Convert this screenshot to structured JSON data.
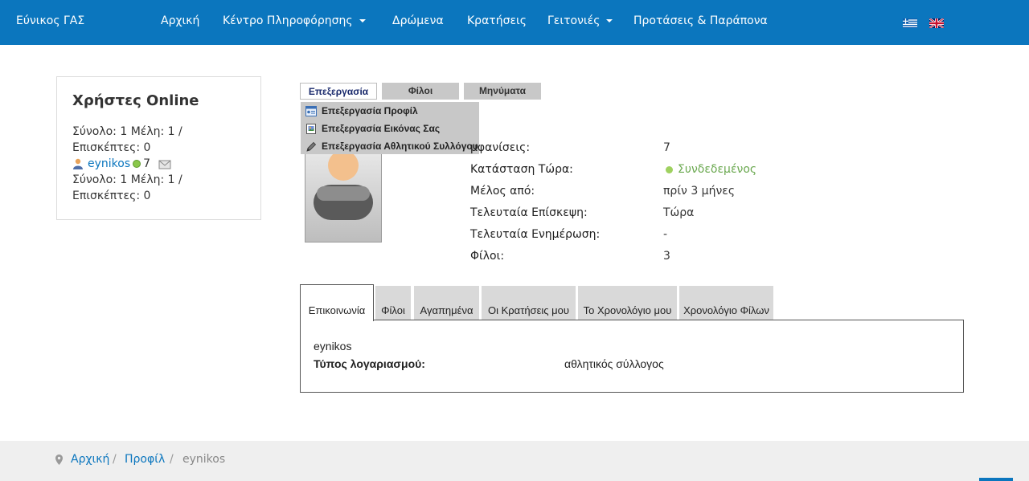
{
  "navbar": {
    "brand": "Εύνικος ΓΑΣ",
    "items": [
      {
        "label": "Αρχική"
      },
      {
        "label": "Κέντρο Πληροφόρησης"
      },
      {
        "label": "Δρώμενα"
      },
      {
        "label": "Κρατήσεις"
      },
      {
        "label": "Γειτονιές"
      },
      {
        "label": "Προτάσεις & Παράπονα"
      }
    ]
  },
  "sidebar": {
    "title": "Χρήστες Online",
    "line1": "Σύνολο: 1 Μέλη: 1 /",
    "line2": "Επισκέπτες: 0",
    "user": "eynikos",
    "user_count": "7",
    "line3": "Σύνολο: 1 Μέλη: 1 /",
    "line4": "Επισκέπτες: 0"
  },
  "profile_tabs": {
    "edit": "Επεξεργασία",
    "friends": "Φίλοι",
    "messages": "Μηνύματα"
  },
  "edit_menu": {
    "items": [
      {
        "label": "Επεξεργασία Προφίλ",
        "icon": "profile-card-icon"
      },
      {
        "label": "Επεξεργασία Εικόνας Σας",
        "icon": "image-icon"
      },
      {
        "label": "Επεξεργασία Αθλητικού Συλλόγου",
        "icon": "pencil-icon"
      }
    ]
  },
  "info": {
    "views_label": "μφανίσεις:",
    "views_value": "7",
    "status_label": "Κατάσταση Τώρα:",
    "status_value": "Συνδεδεμένος",
    "member_since_label": "Μέλος από:",
    "member_since_value": "πρίν 3 μήνες",
    "last_visit_label": "Τελευταία Επίσκεψη:",
    "last_visit_value": "Τώρα",
    "last_update_label": "Τελευταία Ενημέρωση:",
    "last_update_value": "-",
    "friends_label": "Φίλοι:",
    "friends_value": "3"
  },
  "content_tabs": [
    {
      "label": "Επικοινωνία"
    },
    {
      "label": "Φίλοι"
    },
    {
      "label": "Αγαπημένα"
    },
    {
      "label": "Οι Κρατήσεις μου"
    },
    {
      "label": "Το Χρονολόγιο μου"
    },
    {
      "label": "Χρονολόγιο Φίλων"
    }
  ],
  "tab_panel": {
    "username": "eynikos",
    "account_type_label": "Τύπος λογαριασμού:",
    "account_type_value": "αθλητικός σύλλογος"
  },
  "breadcrumb": {
    "home": "Αρχική",
    "profile": "Προφίλ",
    "current": "eynikos",
    "separator": "/"
  },
  "colors": {
    "brand_blue": "#0b76be",
    "online_green": "#6aa84f"
  }
}
